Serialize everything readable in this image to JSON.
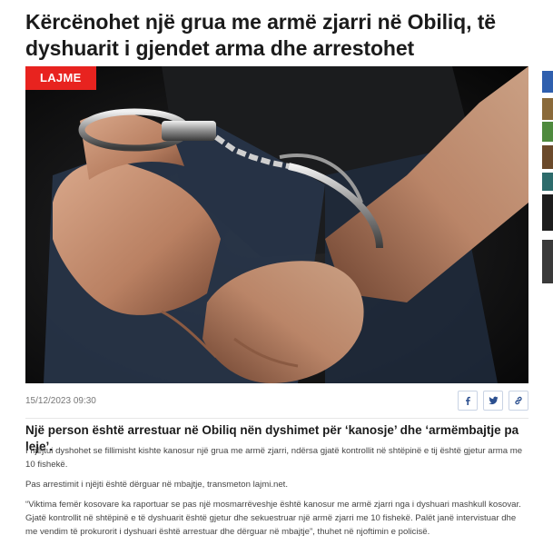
{
  "article": {
    "headline": "Kërcënohet një grua me armë zjarri në Obiliq, të dyshuarit i gjendet arma dhe arrestohet",
    "category": "LAJME",
    "date": "15/12/2023 09:30",
    "lead": "Një person është arrestuar në Obiliq nën dyshimet për ‘kanosje’ dhe ‘armëmbajtje pa leje’.",
    "paragraphs": [
      "I njëjtui dyshohet se fillimisht kishte kanosur një grua me armë zjarri, ndërsa gjatë kontrollit në shtëpinë e tij është gjetur arma me 10 fishekë.",
      "Pas arrestimit i njëjti është dërguar në mbajtje, transmeton lajmi.net.",
      "“Viktima femër kosovare ka raportuar se pas një mosmarrëveshje është kanosur me armë zjarri nga i dyshuari mashkull kosovar. Gjatë kontrollit në shtëpinë e të dyshuarit është gjetur dhe sekuestruar një armë zjarri me 10 fishekë. Palët janë intervistuar dhe me vendim të prokurorit i dyshuari është arrestuar dhe dërguar në mbajtje”, thuhet në njoftimin e policisë."
    ]
  },
  "share": {
    "icons": [
      "facebook-icon",
      "twitter-icon",
      "link-icon"
    ],
    "accent": "#2b4f8f"
  },
  "colors": {
    "badge": "#e8231f"
  }
}
